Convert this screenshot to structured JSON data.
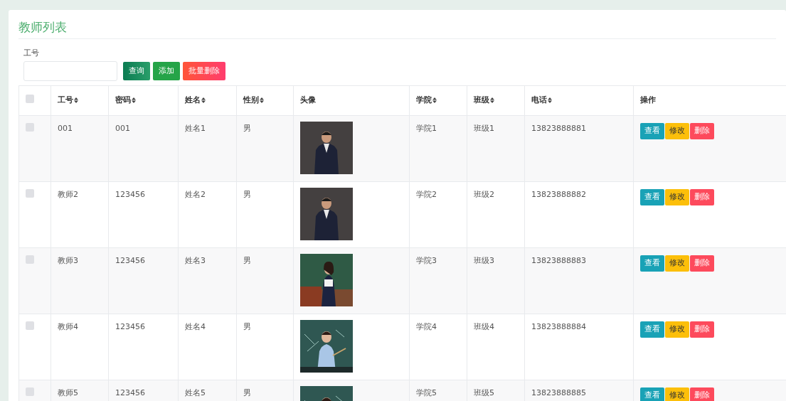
{
  "title": "教师列表",
  "search": {
    "label": "工号"
  },
  "toolbar": [
    {
      "label": "查询",
      "kind": "search"
    },
    {
      "label": "添加",
      "kind": "add"
    },
    {
      "label": "批量删除",
      "kind": "bulk-delete"
    }
  ],
  "table": {
    "select_all": {
      "checked": false
    },
    "columns": [
      {
        "label": "工号",
        "sortable": true
      },
      {
        "label": "密码",
        "sortable": true
      },
      {
        "label": "姓名",
        "sortable": true
      },
      {
        "label": "性别",
        "sortable": true
      },
      {
        "label": "头像",
        "sortable": false
      },
      {
        "label": "学院",
        "sortable": true
      },
      {
        "label": "班级",
        "sortable": true
      },
      {
        "label": "电话",
        "sortable": true
      },
      {
        "label": "操作",
        "sortable": false
      }
    ],
    "rows": [
      {
        "checked": false,
        "cells": [
          "001",
          "001",
          "姓名1",
          "男",
          "",
          "学院1",
          "班级1",
          "13823888881"
        ],
        "actions": [
          {
            "label": "查看",
            "kind": "view"
          },
          {
            "label": "修改",
            "kind": "edit"
          },
          {
            "label": "删除",
            "kind": "delete"
          }
        ]
      },
      {
        "checked": false,
        "cells": [
          "教师2",
          "123456",
          "姓名2",
          "男",
          "",
          "学院2",
          "班级2",
          "13823888882"
        ],
        "actions": [
          {
            "label": "查看",
            "kind": "view"
          },
          {
            "label": "修改",
            "kind": "edit"
          },
          {
            "label": "删除",
            "kind": "delete"
          }
        ]
      },
      {
        "checked": false,
        "cells": [
          "教师3",
          "123456",
          "姓名3",
          "男",
          "",
          "学院3",
          "班级3",
          "13823888883"
        ],
        "actions": [
          {
            "label": "查看",
            "kind": "view"
          },
          {
            "label": "修改",
            "kind": "edit"
          },
          {
            "label": "删除",
            "kind": "delete"
          }
        ]
      },
      {
        "checked": false,
        "cells": [
          "教师4",
          "123456",
          "姓名4",
          "男",
          "",
          "学院4",
          "班级4",
          "13823888884"
        ],
        "actions": [
          {
            "label": "查看",
            "kind": "view"
          },
          {
            "label": "修改",
            "kind": "edit"
          },
          {
            "label": "删除",
            "kind": "delete"
          }
        ]
      },
      {
        "checked": false,
        "cells": [
          "教师5",
          "123456",
          "姓名5",
          "男",
          "",
          "学院5",
          "班级5",
          "13823888885"
        ],
        "actions": [
          {
            "label": "查看",
            "kind": "view"
          },
          {
            "label": "修改",
            "kind": "edit"
          },
          {
            "label": "删除",
            "kind": "delete"
          }
        ]
      }
    ]
  }
}
